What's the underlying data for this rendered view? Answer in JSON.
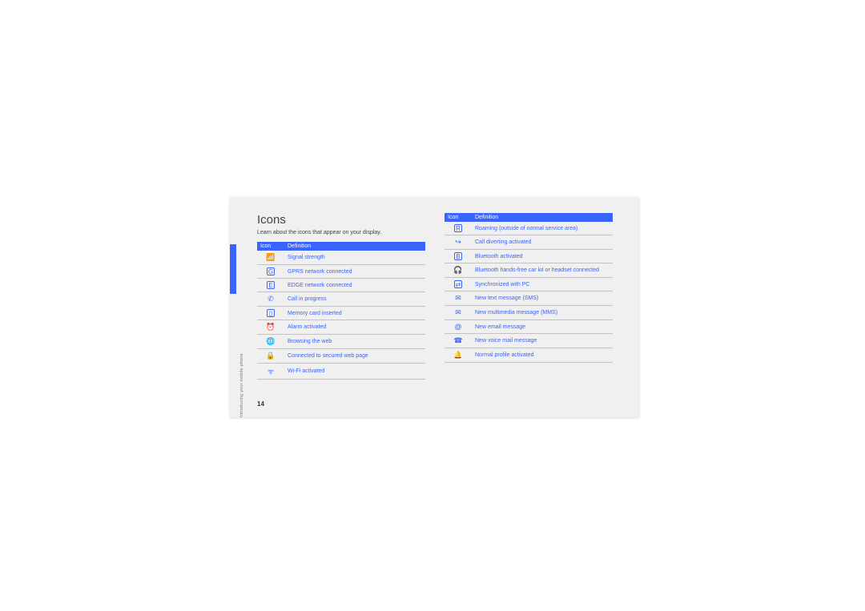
{
  "sideLabel": "Introducing your mobile phone",
  "title": "Icons",
  "intro": "Learn about the icons that appear on your display.",
  "headers": {
    "icon": "Icon",
    "def": "Definition"
  },
  "left": [
    {
      "glyph": "📶",
      "boxed": false,
      "name": "signal-strength-icon",
      "def": "Signal strength"
    },
    {
      "glyph": "G",
      "boxed": true,
      "name": "gprs-icon",
      "def": "GPRS network connected"
    },
    {
      "glyph": "E",
      "boxed": true,
      "name": "edge-icon",
      "def": "EDGE network connected"
    },
    {
      "glyph": "✆",
      "boxed": false,
      "name": "call-progress-icon",
      "def": "Call in progress"
    },
    {
      "glyph": "▯",
      "boxed": true,
      "name": "memory-card-icon",
      "def": "Memory card inserted"
    },
    {
      "glyph": "⏰",
      "boxed": false,
      "name": "alarm-icon",
      "def": "Alarm activated"
    },
    {
      "glyph": "🌐",
      "boxed": false,
      "name": "browsing-web-icon",
      "def": "Browsing the web"
    },
    {
      "glyph": "🔒",
      "boxed": false,
      "name": "secured-web-icon",
      "def": "Connected to secured web page"
    },
    {
      "glyph": "ᯤ",
      "boxed": false,
      "name": "wifi-icon",
      "def": "Wi-Fi activated"
    }
  ],
  "right": [
    {
      "glyph": "R",
      "boxed": true,
      "name": "roaming-icon",
      "def": "Roaming (outside of normal service area)"
    },
    {
      "glyph": "↪",
      "boxed": false,
      "name": "call-divert-icon",
      "def": "Call diverting activated"
    },
    {
      "glyph": "B",
      "boxed": true,
      "name": "bluetooth-icon",
      "def": "Bluetooth activated"
    },
    {
      "glyph": "🎧",
      "boxed": false,
      "name": "bt-headset-icon",
      "def": "Bluetooth hands-free car kit or headset connected"
    },
    {
      "glyph": "⇄",
      "boxed": true,
      "name": "pc-sync-icon",
      "def": "Synchronized with PC"
    },
    {
      "glyph": "✉",
      "boxed": false,
      "name": "sms-icon",
      "def": "New text message (SMS)"
    },
    {
      "glyph": "✉",
      "boxed": false,
      "name": "mms-icon",
      "def": "New multimedia message (MMS)"
    },
    {
      "glyph": "@",
      "boxed": false,
      "name": "email-icon",
      "def": "New email message"
    },
    {
      "glyph": "☎",
      "boxed": false,
      "name": "voicemail-icon",
      "def": "New voice mail message"
    },
    {
      "glyph": "🔔",
      "boxed": false,
      "name": "profile-normal-icon",
      "def": "Normal profile activated"
    }
  ],
  "pageNumber": "14"
}
